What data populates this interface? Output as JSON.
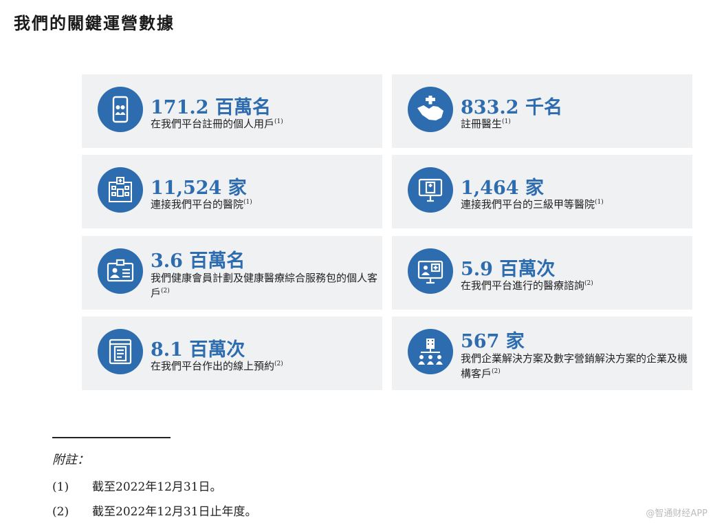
{
  "title": "我們的關鍵運營數據",
  "cards": [
    {
      "stat": "171.2 百萬名",
      "desc": "在我們平台註冊的個人用戶",
      "note": "(1)",
      "icon": "phone-users-icon"
    },
    {
      "stat": "833.2 千名",
      "desc": "註冊醫生",
      "note": "(1)",
      "icon": "medical-handshake-icon"
    },
    {
      "stat": "11,524 家",
      "desc": "連接我們平台的醫院",
      "note": "(1)",
      "icon": "hospital-building-icon"
    },
    {
      "stat": "1,464 家",
      "desc": "連接我們平台的三級甲等醫院",
      "note": "(1)",
      "icon": "hospital-monitor-icon"
    },
    {
      "stat": "3.6 百萬名",
      "desc": "我們健康會員計劃及健康醫療綜合服務包的個人客戶",
      "note": "(2)",
      "icon": "member-card-icon"
    },
    {
      "stat": "5.9 百萬次",
      "desc": "在我們平台進行的醫療諮詢",
      "note": "(2)",
      "icon": "video-consultation-icon"
    },
    {
      "stat": "8.1 百萬次",
      "desc": "在我們平台作出的線上預約",
      "note": "(2)",
      "icon": "online-booking-icon"
    },
    {
      "stat": "567 家",
      "desc": "我們企業解決方案及數字營銷解決方案的企業及機構客戶",
      "note": "(2)",
      "icon": "enterprise-org-icon"
    }
  ],
  "notes": {
    "heading": "附註：",
    "items": [
      {
        "num": "(1)",
        "text": "截至2022年12月31日。"
      },
      {
        "num": "(2)",
        "text": "截至2022年12月31日止年度。"
      }
    ]
  },
  "watermark": "@智通财经APP",
  "colors": {
    "accent": "#2e6cb0",
    "card_bg": "#eff1f3"
  }
}
